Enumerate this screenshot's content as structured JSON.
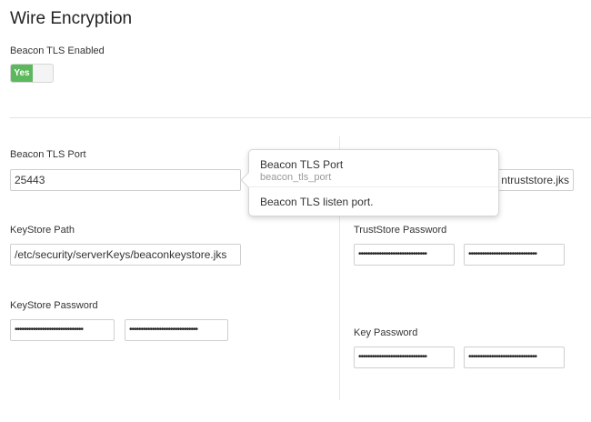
{
  "page": {
    "title": "Wire Encryption"
  },
  "tls_enabled": {
    "label": "Beacon TLS Enabled",
    "toggle_text": "Yes"
  },
  "left": {
    "tls_port": {
      "label": "Beacon TLS Port",
      "value": "25443"
    },
    "keystore_path": {
      "label": "KeyStore Path",
      "value": "/etc/security/serverKeys/beaconkeystore.jks"
    },
    "keystore_password": {
      "label": "KeyStore Password",
      "value": "••••••••••••••••••••••••••••••",
      "confirm": "••••••••••••••••••••••••••••••"
    }
  },
  "right": {
    "truststore_path": {
      "value": "ntruststore.jks"
    },
    "truststore_password": {
      "label": "TrustStore Password",
      "value": "••••••••••••••••••••••••••••••",
      "confirm": "••••••••••••••••••••••••••••••"
    },
    "key_password": {
      "label": "Key Password",
      "value": "••••••••••••••••••••••••••••••",
      "confirm": "••••••••••••••••••••••••••••••"
    }
  },
  "popover": {
    "title": "Beacon TLS Port",
    "property": "beacon_tls_port",
    "description": "Beacon TLS listen port."
  },
  "colors": {
    "toggle_on": "#5cb85c"
  }
}
